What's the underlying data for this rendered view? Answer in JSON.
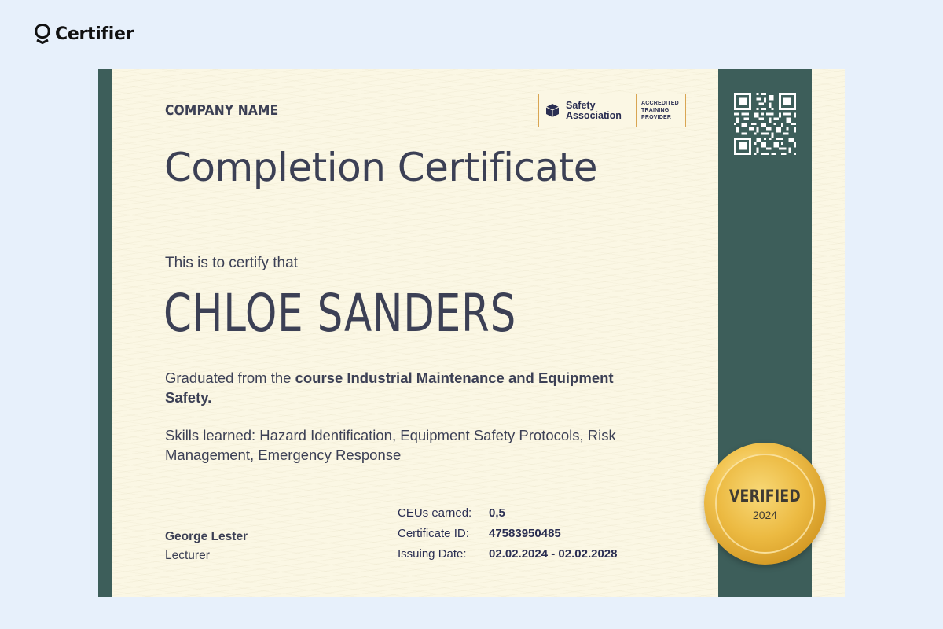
{
  "brand": {
    "name": "Certifier"
  },
  "certificate": {
    "company_name": "COMPANY NAME",
    "badge": {
      "organization": "Safety Association",
      "accreditation": "ACCREDITED TRAINING PROVIDER",
      "icon": "cube-icon"
    },
    "title": "Completion Certificate",
    "certify_text": "This is to certify that",
    "recipient_name": "CHLOE SANDERS",
    "course": {
      "prefix": "Graduated from the ",
      "name": "course Industrial Maintenance and Equipment Safety."
    },
    "skills": "Skills learned: Hazard Identification, Equipment Safety Protocols, Risk Management, Emergency Response",
    "signer": {
      "name": "George Lester",
      "role": "Lecturer"
    },
    "details": [
      {
        "label": "CEUs earned:",
        "value": "0,5"
      },
      {
        "label": "Certificate ID:",
        "value": "47583950485"
      },
      {
        "label": "Issuing Date:",
        "value": "02.02.2024 - 02.02.2028"
      }
    ],
    "seal": {
      "title": "VERIFIED",
      "year": "2024"
    },
    "colors": {
      "band": "#3d5e5a",
      "paper": "#fbf7e4",
      "text": "#3c4055",
      "gold": "#ecba42"
    }
  }
}
